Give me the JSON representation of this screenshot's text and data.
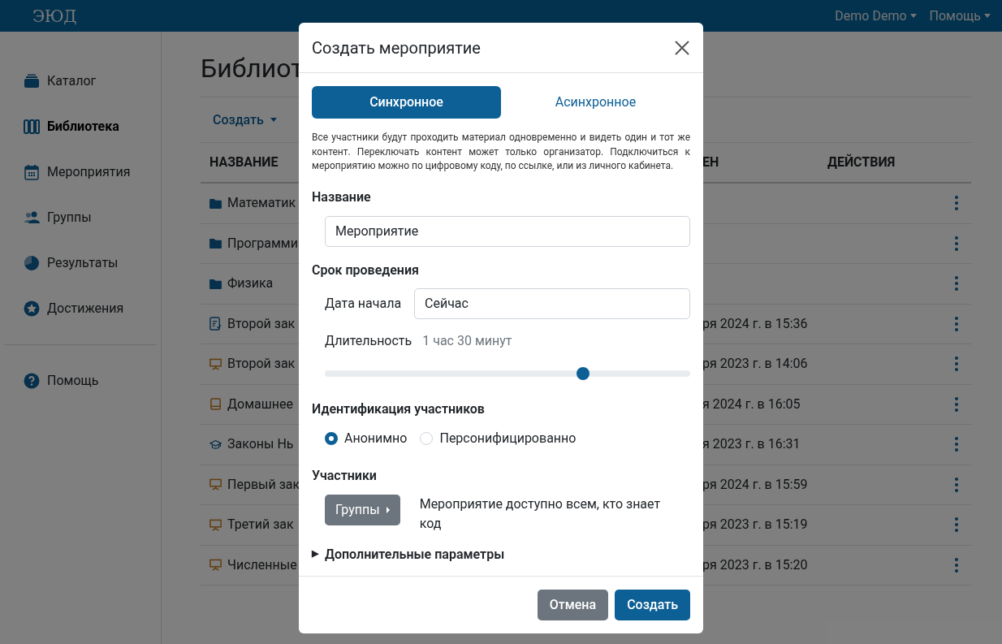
{
  "navbar": {
    "logo": "ЭЮД",
    "menus": [
      {
        "label": "Demo Demo"
      },
      {
        "label": "Помощь"
      }
    ]
  },
  "sidebar": {
    "items": [
      {
        "label": "Каталог",
        "kind": "catalog",
        "selected": false
      },
      {
        "label": "Библиотека",
        "kind": "library",
        "selected": true
      },
      {
        "label": "Мероприятия",
        "kind": "calendar",
        "selected": false
      },
      {
        "label": "Группы",
        "kind": "users",
        "selected": false
      },
      {
        "label": "Результаты",
        "kind": "pie",
        "selected": false
      },
      {
        "label": "Достижения",
        "kind": "star",
        "selected": false
      }
    ],
    "bottom_items": [
      {
        "label": "Помощь",
        "kind": "help",
        "selected": false
      }
    ]
  },
  "page": {
    "title": "Библиот",
    "toolbar": {
      "create": "Создать"
    },
    "table": {
      "columns": [
        "НАЗВАНИЕ",
        "ЕН",
        "ДЕЙСТВИЯ"
      ],
      "rows": [
        {
          "kind": "folder",
          "name": "Математик",
          "date": ""
        },
        {
          "kind": "folder",
          "name": "Программи",
          "date": ""
        },
        {
          "kind": "folder",
          "name": "Физика",
          "date": ""
        },
        {
          "kind": "test",
          "name": "Второй зак",
          "date": "ря 2024 г. в 15:36"
        },
        {
          "kind": "presentation",
          "name": "Второй зак",
          "date": "ря 2023 г. в 14:06"
        },
        {
          "kind": "book",
          "name": "Домашнее",
          "date": "я 2024 г. в 16:05"
        },
        {
          "kind": "course",
          "name": "Законы Нь",
          "date": "я 2023 г. в 16:31"
        },
        {
          "kind": "presentation",
          "name": "Первый зак",
          "date": "ря 2024 г. в 15:59"
        },
        {
          "kind": "presentation",
          "name": "Третий зак",
          "date": "ря 2023 г. в 15:19"
        },
        {
          "kind": "presentation",
          "name": "Численные",
          "date": "ря 2023 г. в 15:20"
        }
      ]
    }
  },
  "modal": {
    "title": "Создать мероприятие",
    "tabs": [
      {
        "label": "Синхронное",
        "selected": true
      },
      {
        "label": "Асинхронное",
        "selected": false
      }
    ],
    "description": "Все участники будут проходить материал одновременно и видеть один и тот же контент. Переключать контент может только организатор. Подключиться к мероприятию можно по цифровому коду, по ссылке, или из личного кабинета.",
    "name_label": "Название",
    "name_value": "Мероприятие",
    "period_label": "Срок проведения",
    "start_label": "Дата начала",
    "start_value": "Сейчас",
    "duration_label": "Длительность",
    "duration_value": "1 час 30 минут",
    "duration_slider": {
      "level": 0.707
    },
    "identification_label": "Идентификация участников",
    "identification_options": [
      {
        "label": "Анонимно",
        "selected": true
      },
      {
        "label": "Персонифицированно",
        "selected": false
      }
    ],
    "participants_label": "Участники",
    "groups_button": "Группы",
    "participants_note": "Мероприятие доступно всем, кто знает код",
    "advanced_toggle": "▶",
    "advanced_label": "Дополнительные параметры",
    "advanced_expanded": false,
    "buttons": [
      {
        "label": "Отмена",
        "kind": "secondary"
      },
      {
        "label": "Создать",
        "kind": "primary"
      }
    ]
  }
}
